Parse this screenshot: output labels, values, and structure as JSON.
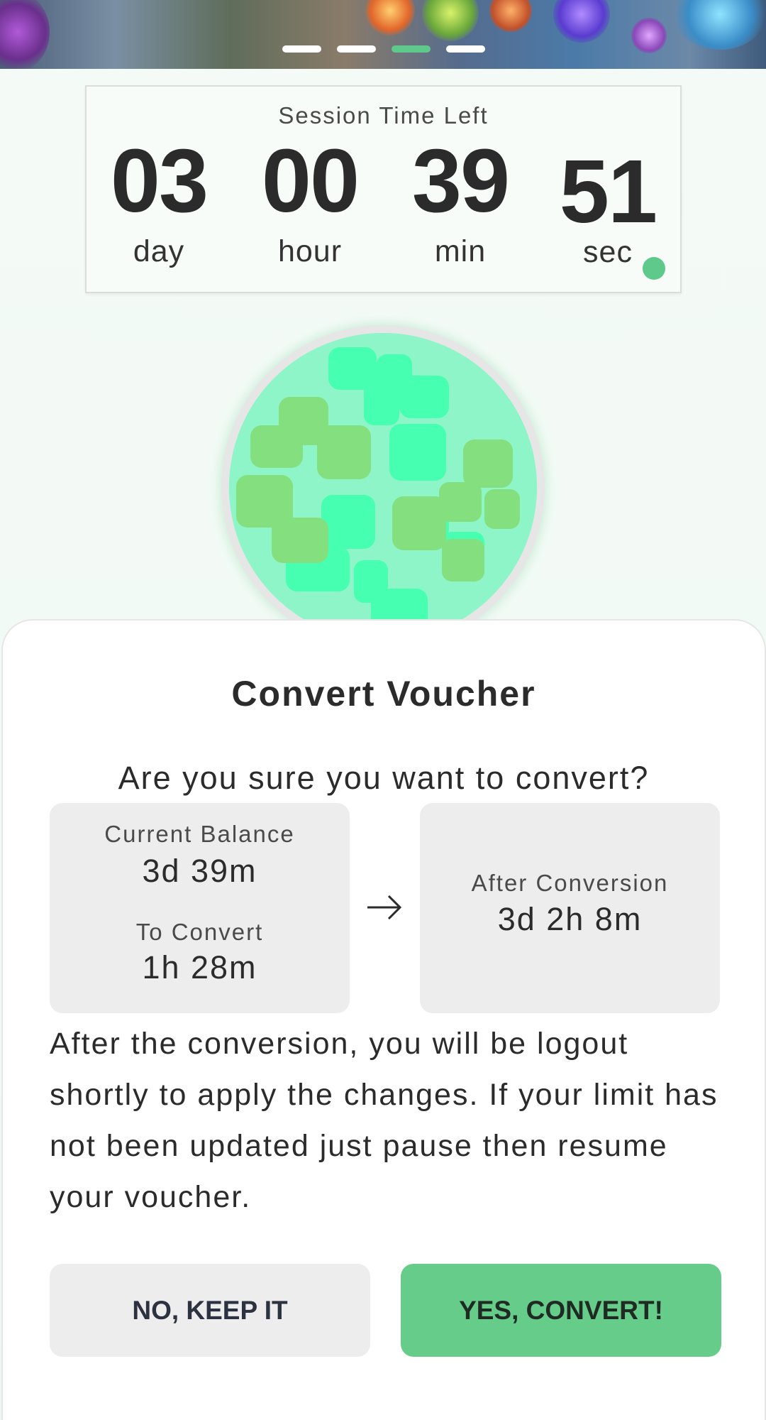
{
  "banner": {
    "carousel_dots": 4,
    "active_dot_index": 2
  },
  "timer": {
    "title": "Session Time Left",
    "units": [
      {
        "value": "03",
        "label": "day"
      },
      {
        "value": "00",
        "label": "hour"
      },
      {
        "value": "39",
        "label": "min"
      },
      {
        "value": "51",
        "label": "sec"
      }
    ],
    "status_color": "#5ec98a"
  },
  "dialog": {
    "title": "Convert Voucher",
    "question": "Are you sure you want to convert?",
    "current_balance_label": "Current Balance",
    "current_balance_value": "3d 39m",
    "to_convert_label": "To Convert",
    "to_convert_value": "1h 28m",
    "after_conversion_label": "After Conversion",
    "after_conversion_value": "3d 2h 8m",
    "arrow_icon": "arrow-right-icon",
    "note": "After the conversion, you will be logout shortly to apply the changes. If your limit has not been updated just pause then resume your voucher.",
    "cancel_label": "NO, KEEP IT",
    "confirm_label": "YES, CONVERT!",
    "accent_color": "#66cc8a"
  }
}
